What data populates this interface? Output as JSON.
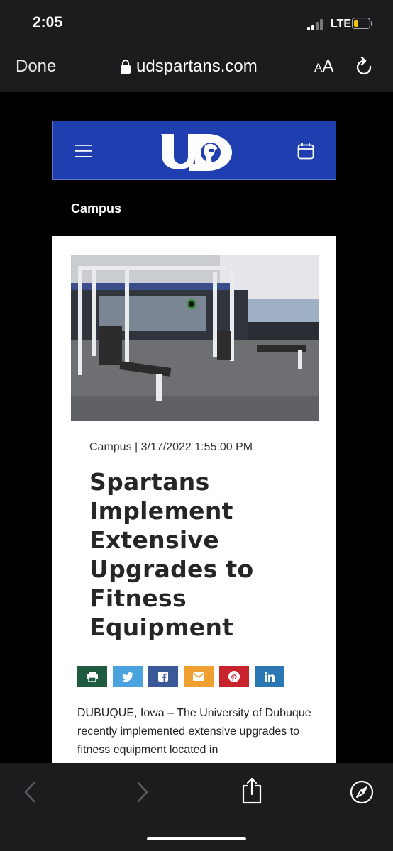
{
  "status": {
    "time": "2:05",
    "network": "LTE"
  },
  "browser": {
    "done_label": "Done",
    "url": "udspartans.com",
    "aa_large": "A",
    "aa_small": "A"
  },
  "site": {
    "section": "Campus"
  },
  "article": {
    "meta": "Campus | 3/17/2022 1:55:00 PM",
    "headline": "Spartans Implement Extensive Upgrades to Fitness Equipment",
    "body": "DUBUQUE, Iowa – The University of Dubuque recently implemented extensive upgrades to fitness equipment located in"
  },
  "share": [
    {
      "name": "print",
      "icon": "printer-icon",
      "color": "#1f5c3f"
    },
    {
      "name": "twitter",
      "icon": "twitter-icon",
      "color": "#4aa3df"
    },
    {
      "name": "facebook",
      "icon": "facebook-icon",
      "color": "#3b5998"
    },
    {
      "name": "email",
      "icon": "mail-icon",
      "color": "#f0a030"
    },
    {
      "name": "pinterest",
      "icon": "pinterest-icon",
      "color": "#c8232c"
    },
    {
      "name": "linkedin",
      "icon": "linkedin-icon",
      "color": "#2a77b4"
    }
  ],
  "colors": {
    "brand_blue": "#1f3fb0",
    "battery_low": "#f4c20d"
  }
}
